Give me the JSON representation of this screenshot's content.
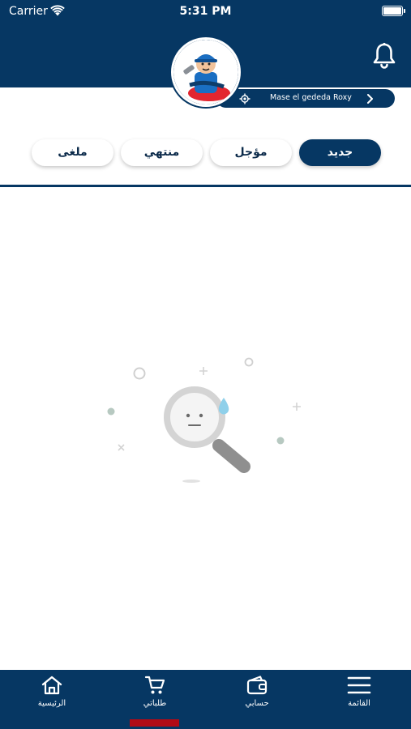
{
  "status_bar": {
    "carrier": "Carrier",
    "time": "5:31 PM"
  },
  "header": {
    "address": "Mase el gededa Roxy"
  },
  "tabs": [
    {
      "label": "جديد",
      "active": true
    },
    {
      "label": "مؤجل",
      "active": false
    },
    {
      "label": "منتهي",
      "active": false
    },
    {
      "label": "ملغى",
      "active": false
    }
  ],
  "bottom_nav": {
    "items": [
      {
        "label": "القائمة",
        "icon": "menu-icon"
      },
      {
        "label": "حسابي",
        "icon": "wallet-icon"
      },
      {
        "label": "طلباتي",
        "icon": "cart-icon",
        "active": true
      },
      {
        "label": "الرئيسية",
        "icon": "home-icon"
      }
    ]
  },
  "colors": {
    "primary": "#063763",
    "active_indicator": "#b10b16",
    "background": "#ffffff"
  }
}
